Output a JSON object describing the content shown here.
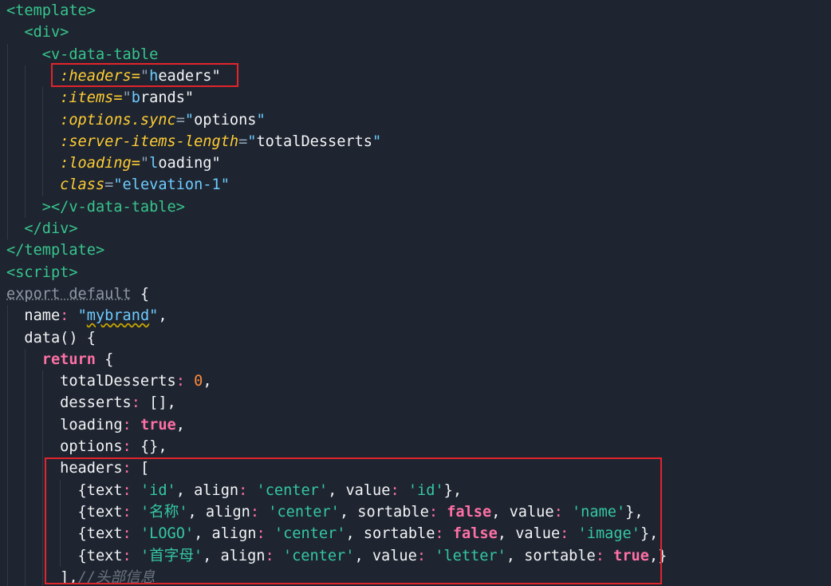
{
  "editor": {
    "lines": [
      "<template>",
      "  <div>",
      "    <v-data-table",
      "      :headers=\"headers\"",
      "      :items=\"brands\"",
      "      :options.sync=\"options\"",
      "      :server-items-length=\"totalDesserts\"",
      "      :loading=\"loading\"",
      "      class=\"elevation-1\"",
      "    ></v-data-table>",
      "  </div>",
      "</template>",
      "<script>",
      "export default {",
      "  name: \"mybrand\",",
      "  data() {",
      "    return {",
      "      totalDesserts: 0,",
      "      desserts: [],",
      "      loading: true,",
      "      options: {},",
      "      headers: [",
      "        {text: 'id', align: 'center', value: 'id'},",
      "        {text: '名称', align: 'center', sortable: false, value: 'name'},",
      "        {text: 'LOGO', align: 'center', sortable: false, value: 'image'},",
      "        {text: '首字母', align: 'center', value: 'letter', sortable: true,}",
      "      ],//头部信息"
    ]
  },
  "colors": {
    "background": "#1e2530",
    "tag": "#37c48c",
    "attribute": "#ffcc33",
    "string": "#6ecbff",
    "keyword": "#ff70a6",
    "single_quoted_string": "#35c7a4",
    "number": "#ff8a3d",
    "comment": "#6c7480",
    "highlight_box": "#e2242c"
  }
}
